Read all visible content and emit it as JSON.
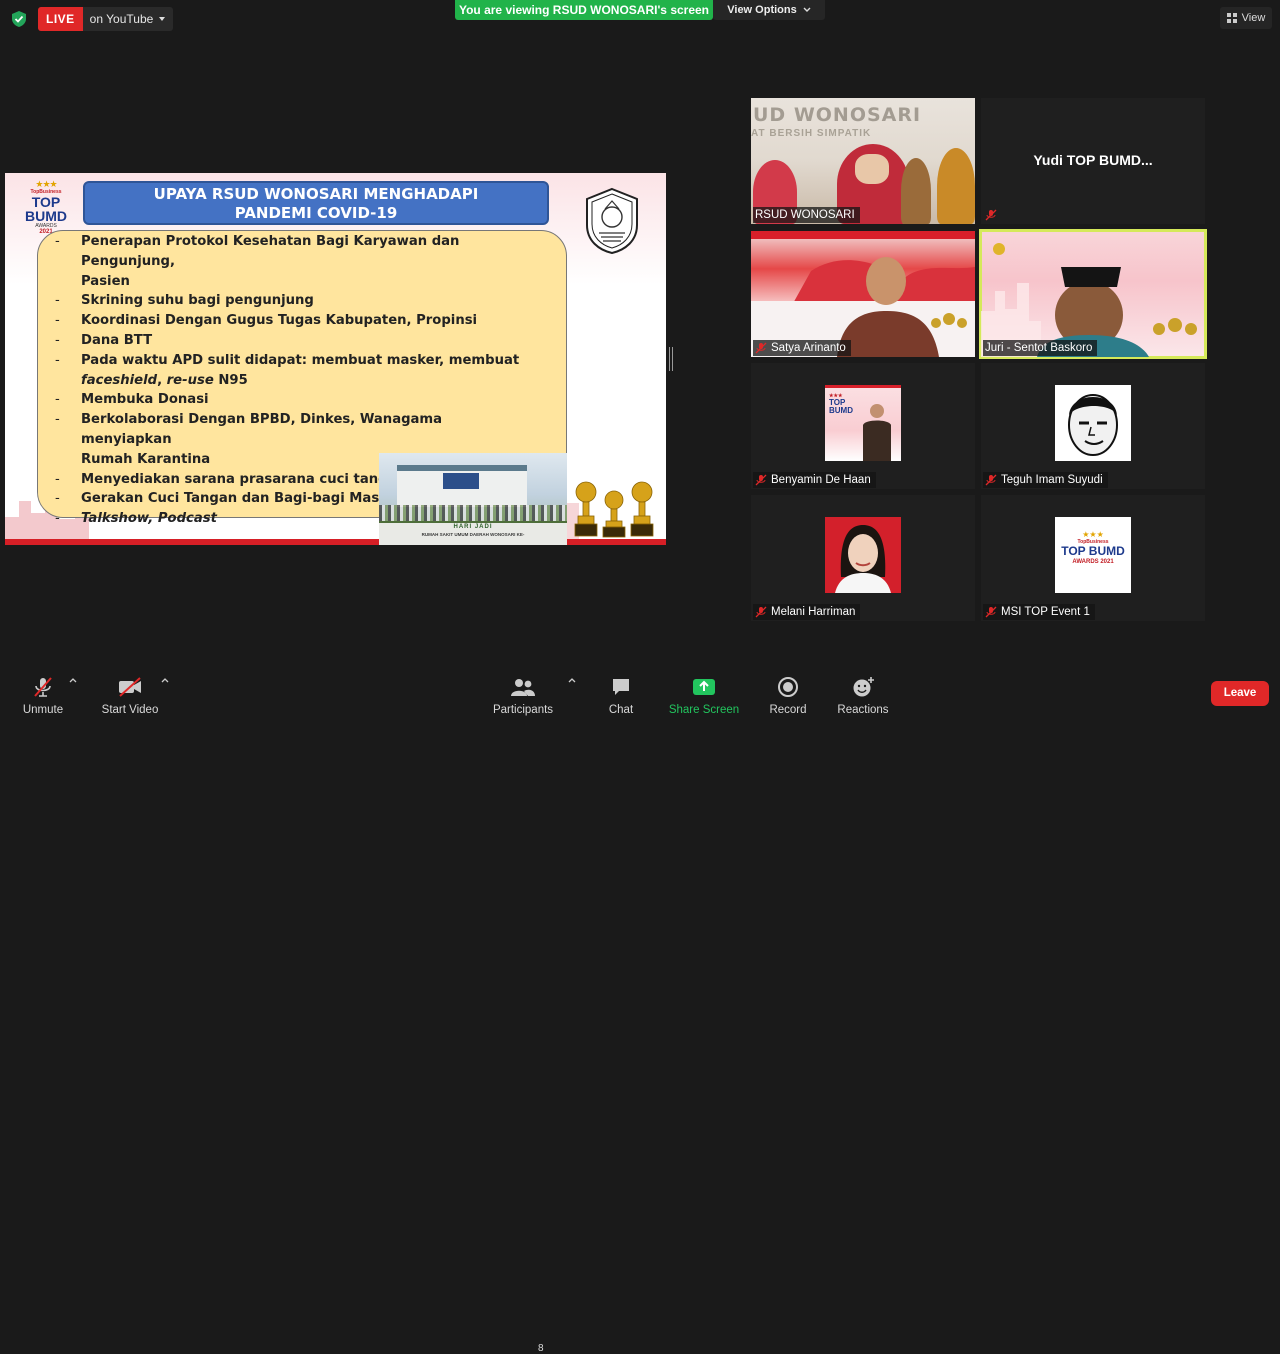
{
  "top": {
    "live_badge": "LIVE",
    "live_destination": "on YouTube",
    "viewing_banner": "You are viewing RSUD WONOSARI's screen",
    "view_options": "View Options",
    "view_button": "View"
  },
  "slide": {
    "logo": {
      "brand": "TopBusiness",
      "top": "TOP",
      "bumd": "BUMD",
      "awards": "AWARDS",
      "year": "2021"
    },
    "title_line1": "UPAYA RSUD WONOSARI MENGHADAPI",
    "title_line2": "PANDEMI COVID-19",
    "bullets": [
      {
        "lines": [
          "Penerapan Protokol Kesehatan Bagi Karyawan dan Pengunjung,",
          "Pasien"
        ]
      },
      {
        "lines": [
          "Skrining suhu bagi pengunjung"
        ]
      },
      {
        "lines": [
          "Koordinasi Dengan Gugus Tugas Kabupaten, Propinsi"
        ]
      },
      {
        "lines": [
          "Dana BTT"
        ]
      },
      {
        "lines": [
          "Pada waktu APD sulit didapat: membuat masker, membuat"
        ],
        "rich": [
          {
            "t": "faceshield",
            "i": true
          },
          {
            "t": ", ",
            "i": false
          },
          {
            "t": "re-use",
            "i": true
          },
          {
            "t": " N95",
            "i": false
          }
        ]
      },
      {
        "lines": [
          "Membuka Donasi"
        ]
      },
      {
        "lines": [
          "Berkolaborasi Dengan BPBD, Dinkes, Wanagama menyiapkan",
          "Rumah Karantina"
        ]
      },
      {
        "lines": [
          "Menyediakan sarana prasarana cuci tangan"
        ]
      },
      {
        "lines": [
          "Gerakan Cuci Tangan dan Bagi-bagi Masker"
        ]
      },
      {
        "lines": [
          "Talkshow, Podcast"
        ],
        "italic": true
      }
    ],
    "photo_banner_title": "HARI JADI",
    "photo_banner_sub": "RUMAH SAKIT UMUM DAERAH WONOSARI KE-"
  },
  "participants": [
    {
      "name": "RSUD WONOSARI",
      "type": "video-rsud",
      "muted": false,
      "wall_text": "UD WONOSARI",
      "wall_text2": "AT BERSIH SIMPATIK"
    },
    {
      "name": "Yudi TOP BUMD...",
      "type": "name-only",
      "muted": true
    },
    {
      "name": "Satya Arinanto",
      "type": "video-satya",
      "muted": true
    },
    {
      "name": "Juri - Sentot Baskoro",
      "type": "video-juri",
      "muted": false,
      "speaking": true
    },
    {
      "name": "Benyamin De Haan",
      "type": "avatar",
      "muted": true
    },
    {
      "name": "Teguh Imam Suyudi",
      "type": "avatar",
      "muted": true
    },
    {
      "name": "Melani Harriman",
      "type": "avatar",
      "muted": true
    },
    {
      "name": "MSI TOP Event 1",
      "type": "avatar-logo",
      "muted": true,
      "logo": {
        "brand": "TopBusiness",
        "line1": "TOP BUMD",
        "line2": "AWARDS 2021"
      }
    }
  ],
  "toolbar": {
    "unmute": "Unmute",
    "start_video": "Start Video",
    "participants": "Participants",
    "participants_count": "8",
    "chat": "Chat",
    "share_screen": "Share Screen",
    "record": "Record",
    "reactions": "Reactions",
    "leave": "Leave"
  },
  "colors": {
    "live_red": "#e02828",
    "share_green": "#22c55e",
    "banner_green": "#21b34a",
    "speaking_outline": "#d5e95a",
    "slide_title_blue": "#4472c4",
    "bullet_box": "#ffe59e"
  }
}
